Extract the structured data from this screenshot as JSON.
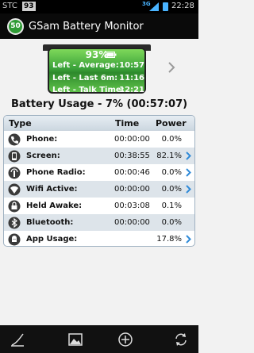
{
  "status_bar": {
    "carrier": "STC",
    "badge": "93",
    "network": "3G",
    "time": "22:28"
  },
  "app": {
    "logo_text": "50",
    "title": "GSam Battery Monitor"
  },
  "battery": {
    "percent": "93%",
    "level": 0.93,
    "rows": [
      {
        "label": "Left - Average:",
        "value": "10:57"
      },
      {
        "label": "Left - Last 6m:",
        "value": "11:16"
      },
      {
        "label": "Left - Talk Time:",
        "value": "12:21"
      }
    ]
  },
  "usage": {
    "title": "Battery Usage - 7% (00:57:07)"
  },
  "table": {
    "headers": {
      "type": "Type",
      "time": "Time",
      "power": "Power"
    },
    "rows": [
      {
        "name": "Phone:",
        "time": "00:00:00",
        "power": "0.0%",
        "icon": "phone-icon",
        "chevron": false
      },
      {
        "name": "Screen:",
        "time": "00:38:55",
        "power": "82.1%",
        "icon": "screen-icon",
        "chevron": true
      },
      {
        "name": "Phone Radio:",
        "time": "00:00:46",
        "power": "0.0%",
        "icon": "radio-icon",
        "chevron": true
      },
      {
        "name": "Wifi Active:",
        "time": "00:00:00",
        "power": "0.0%",
        "icon": "wifi-icon",
        "chevron": true
      },
      {
        "name": "Held Awake:",
        "time": "00:03:08",
        "power": "0.1%",
        "icon": "lock-icon",
        "chevron": false
      },
      {
        "name": "Bluetooth:",
        "time": "00:00:00",
        "power": "0.0%",
        "icon": "bluetooth-icon",
        "chevron": false
      },
      {
        "name": "App Usage:",
        "time": "",
        "power": "17.8%",
        "icon": "app-icon",
        "chevron": true
      }
    ]
  },
  "bottom_bar": {
    "buttons": [
      "graph-icon",
      "image-icon",
      "add-icon",
      "refresh-icon"
    ]
  },
  "colors": {
    "accent": "#2f8ad8",
    "battery_green": "#3ba23a",
    "header_bg": "#cbd6df"
  }
}
